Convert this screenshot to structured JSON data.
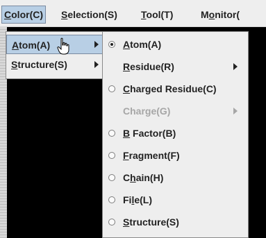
{
  "menubar": {
    "items": [
      {
        "label": "Color(C)",
        "mnemonic": "C",
        "active": true
      },
      {
        "label": "Selection(S)",
        "mnemonic": "S"
      },
      {
        "label": "Tool(T)",
        "mnemonic": "T"
      },
      {
        "label": "Monitor(",
        "mnemonic": "o"
      }
    ]
  },
  "color_menu": {
    "items": [
      {
        "label": "Atom(A)",
        "submenu": true,
        "selected": true
      },
      {
        "label": "Structure(S)",
        "submenu": true
      }
    ]
  },
  "atom_submenu": {
    "items": [
      {
        "label": "Atom(A)",
        "radio": true,
        "checked": true
      },
      {
        "label": "Residue(R)",
        "submenu": true
      },
      {
        "label": "Charged Residue(C)",
        "radio": true
      },
      {
        "label": "Charge(G)",
        "submenu": true,
        "disabled": true
      },
      {
        "label": "B Factor(B)",
        "radio": true
      },
      {
        "label": "Fragment(F)",
        "radio": true
      },
      {
        "label": "Chain(H)",
        "radio": true
      },
      {
        "label": "File(L)",
        "radio": true
      },
      {
        "label": "Structure(S)",
        "radio": true
      }
    ]
  },
  "colors": {
    "selection_bg": "#b8cfe5",
    "canvas_bg": "#000000",
    "disabled_text": "#a6a6a6"
  }
}
